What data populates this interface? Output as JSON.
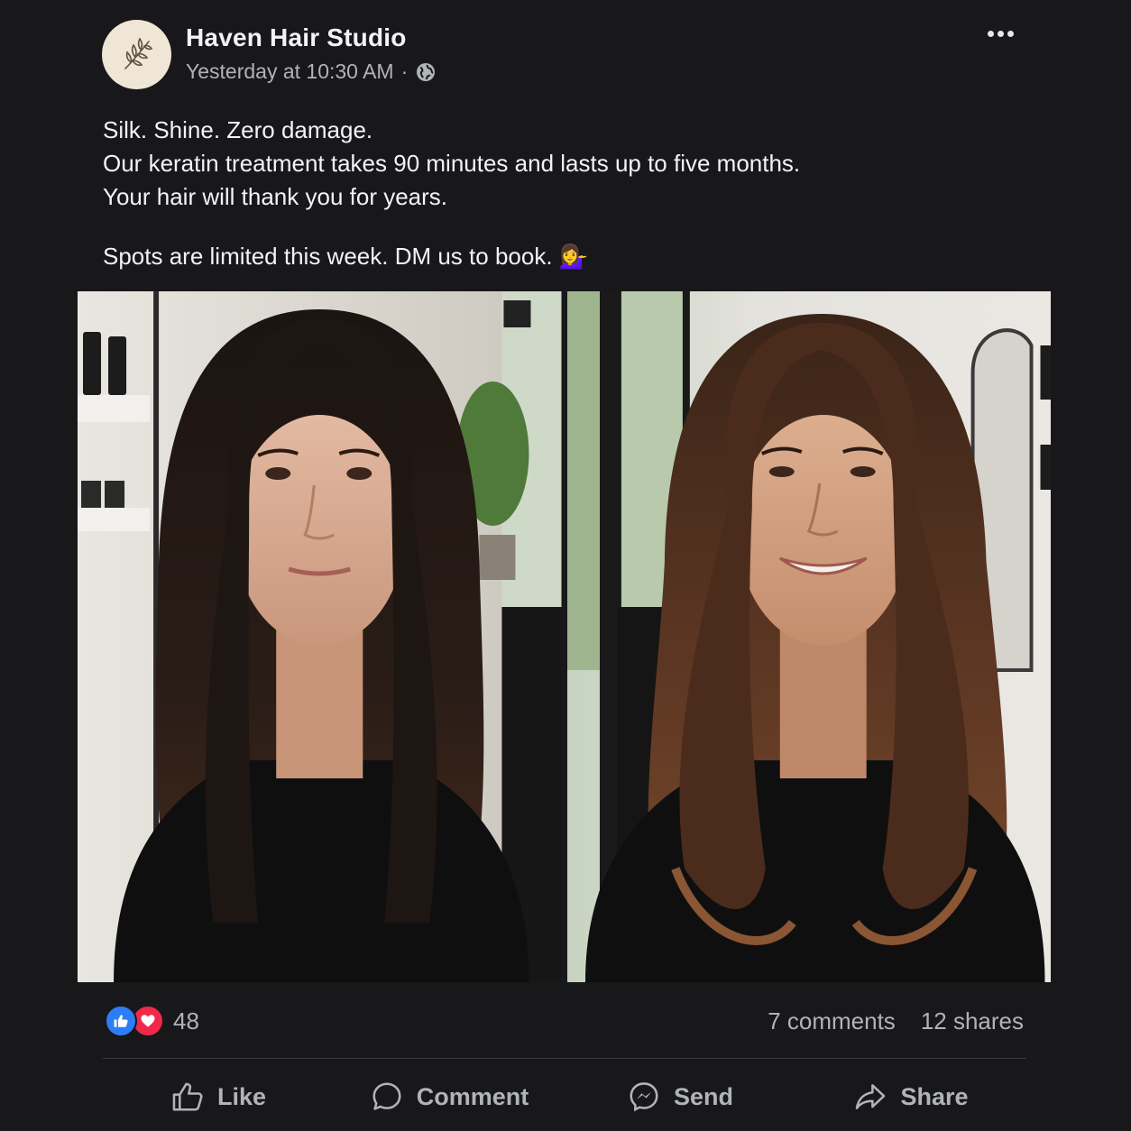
{
  "page": {
    "name": "Haven Hair Studio",
    "timestamp": "Yesterday at 10:30 AM",
    "separator": "·",
    "privacy_icon": "globe-icon"
  },
  "post": {
    "lines": [
      "Silk. Shine. Zero damage.",
      "Our keratin treatment takes 90 minutes and lasts up to five months.",
      "Your hair will thank you for years."
    ],
    "cta": "Spots are limited this week. DM us to book.",
    "cta_emoji": "💁‍♀️"
  },
  "photos": {
    "before_hair_color": "#2a1d17",
    "after_hair_color": "#5a3522"
  },
  "stats": {
    "reaction_count": "48",
    "comments": "7 comments",
    "shares": "12 shares"
  },
  "actions": {
    "like": "Like",
    "comment": "Comment",
    "send": "Send",
    "share": "Share"
  },
  "colors": {
    "background": "#18181a",
    "like_blue": "#2d7df6",
    "love_red": "#f02849",
    "secondary_text": "#b0b3b8"
  }
}
